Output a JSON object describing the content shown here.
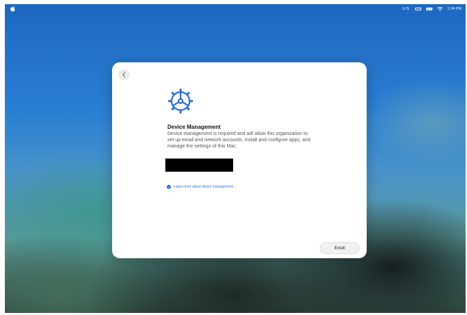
{
  "menubar": {
    "keyboard_layout": "U.S.",
    "time": "1:34 PM",
    "icons": [
      "apple-icon",
      "flag-icon",
      "battery-icon",
      "wifi-icon"
    ]
  },
  "dialog": {
    "back_icon": "chevron-left-icon",
    "header_icon": "gear-icon",
    "title": "Device Management",
    "description": "Device management is required and will allow this organization to set up email and network accounts, install and configure apps, and manage the settings of this Mac.",
    "learn_more": "Learn more about device management…",
    "enroll_label": "Enroll",
    "accent_color": "#2a6fd6"
  }
}
